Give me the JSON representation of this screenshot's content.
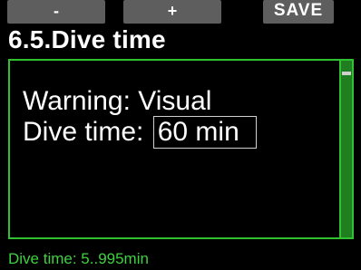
{
  "softkeys": {
    "left_label": "-",
    "center_label": "+",
    "right_label": "SAVE"
  },
  "screen": {
    "title": "6.5.Dive time"
  },
  "panel": {
    "warning_label": "Warning:",
    "warning_value": "Visual",
    "dive_time_label": "Dive time:",
    "dive_time_value": "60 min"
  },
  "footer": {
    "hint": "Dive time: 5..995min"
  },
  "colors": {
    "accent_green": "#2fc12f",
    "softkey_gray": "#5e5e5e",
    "background": "#000000"
  }
}
